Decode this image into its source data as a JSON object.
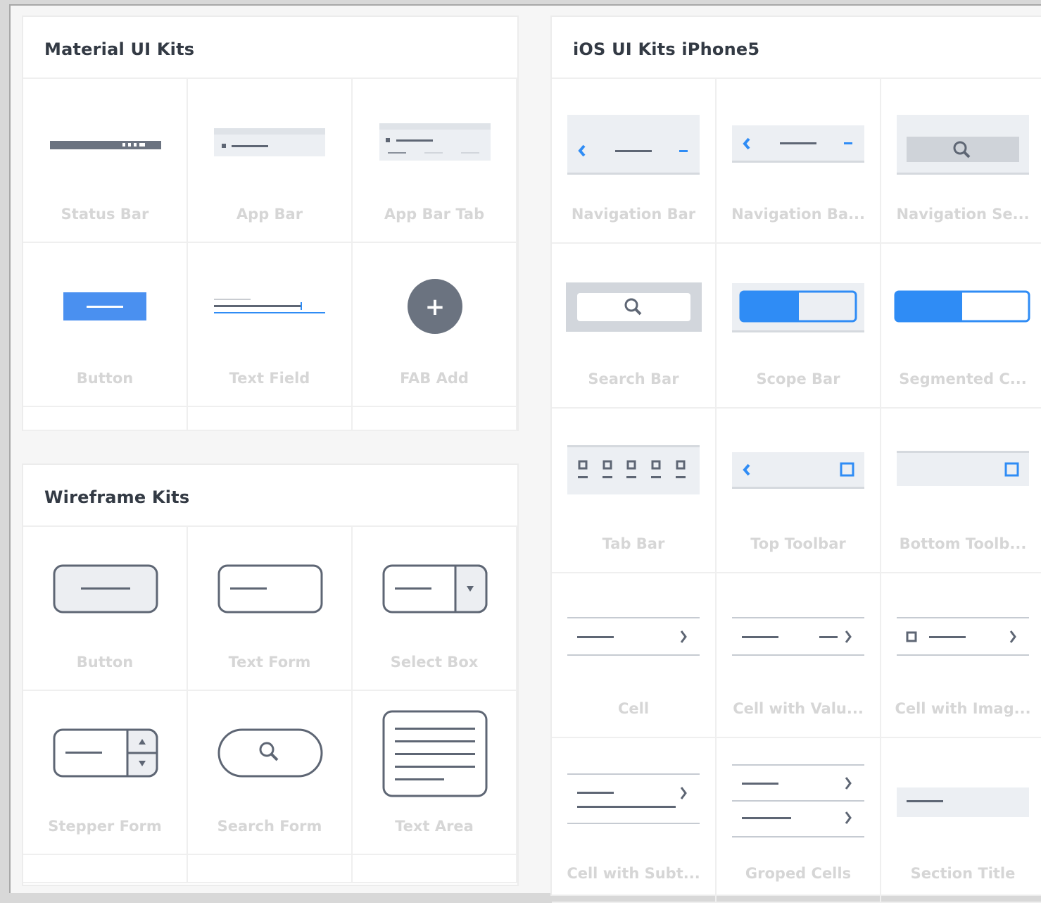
{
  "material": {
    "title": "Material UI Kits",
    "items": [
      {
        "label": "Status Bar",
        "icon": "status-bar-icon"
      },
      {
        "label": "App Bar",
        "icon": "app-bar-icon"
      },
      {
        "label": "App Bar Tab",
        "icon": "app-bar-tab-icon"
      },
      {
        "label": "Button",
        "icon": "material-button-icon"
      },
      {
        "label": "Text Field",
        "icon": "text-field-icon"
      },
      {
        "label": "FAB Add",
        "icon": "fab-add-icon",
        "glyph": "+"
      }
    ]
  },
  "wireframe": {
    "title": "Wireframe Kits",
    "items": [
      {
        "label": "Button",
        "icon": "wireframe-button-icon"
      },
      {
        "label": "Text Form",
        "icon": "text-form-icon"
      },
      {
        "label": "Select Box",
        "icon": "select-box-icon"
      },
      {
        "label": "Stepper Form",
        "icon": "stepper-form-icon"
      },
      {
        "label": "Search Form",
        "icon": "search-form-icon"
      },
      {
        "label": "Text Area",
        "icon": "text-area-icon"
      }
    ]
  },
  "ios": {
    "title": "iOS UI Kits iPhone5",
    "items": [
      {
        "label": "Navigation Bar",
        "icon": "navigation-bar-icon"
      },
      {
        "label": "Navigation Ba...",
        "icon": "navigation-bar-variant-icon"
      },
      {
        "label": "Navigation Se...",
        "icon": "navigation-search-icon"
      },
      {
        "label": "Search Bar",
        "icon": "search-bar-icon"
      },
      {
        "label": "Scope Bar",
        "icon": "scope-bar-icon"
      },
      {
        "label": "Segmented C...",
        "icon": "segmented-control-icon"
      },
      {
        "label": "Tab Bar",
        "icon": "tab-bar-icon"
      },
      {
        "label": "Top Toolbar",
        "icon": "top-toolbar-icon"
      },
      {
        "label": "Bottom Toolb...",
        "icon": "bottom-toolbar-icon"
      },
      {
        "label": "Cell",
        "icon": "cell-icon"
      },
      {
        "label": "Cell with Valu...",
        "icon": "cell-with-value-icon"
      },
      {
        "label": "Cell with Imag...",
        "icon": "cell-with-image-icon"
      },
      {
        "label": "Cell with Subt...",
        "icon": "cell-with-subtitle-icon"
      },
      {
        "label": "Groped Cells",
        "icon": "grouped-cells-icon"
      },
      {
        "label": "Section Title",
        "icon": "section-title-icon"
      }
    ]
  },
  "colors": {
    "blue": "#2f8cf5",
    "gray_line": "#5e6674",
    "light_fill": "#eceff3",
    "label": "#d6d6d6"
  }
}
